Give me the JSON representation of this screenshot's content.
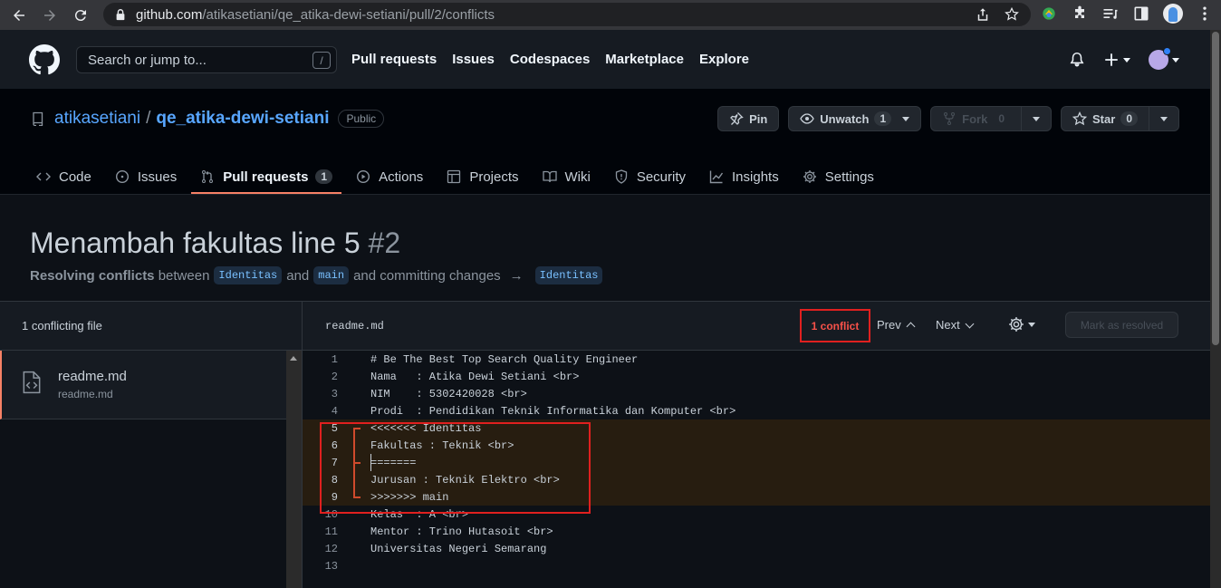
{
  "browser": {
    "url_host": "github.com",
    "url_path": "/atikasetiani/qe_atika-dewi-setiani/pull/2/conflicts"
  },
  "header": {
    "search_placeholder": "Search or jump to...",
    "slash_key": "/",
    "nav": [
      "Pull requests",
      "Issues",
      "Codespaces",
      "Marketplace",
      "Explore"
    ]
  },
  "repo": {
    "owner": "atikasetiani",
    "separator": "/",
    "name": "qe_atika-dewi-setiani",
    "visibility": "Public",
    "pin_label": "Pin",
    "watch_label": "Unwatch",
    "watch_count": "1",
    "fork_label": "Fork",
    "fork_count": "0",
    "star_label": "Star",
    "star_count": "0",
    "tabs": [
      {
        "label": "Code",
        "icon": "code-icon"
      },
      {
        "label": "Issues",
        "icon": "issue-icon"
      },
      {
        "label": "Pull requests",
        "icon": "git-pull-request-icon",
        "count": "1",
        "active": true
      },
      {
        "label": "Actions",
        "icon": "play-icon"
      },
      {
        "label": "Projects",
        "icon": "table-icon"
      },
      {
        "label": "Wiki",
        "icon": "book-icon"
      },
      {
        "label": "Security",
        "icon": "shield-icon"
      },
      {
        "label": "Insights",
        "icon": "graph-icon"
      },
      {
        "label": "Settings",
        "icon": "gear-icon"
      }
    ]
  },
  "pr": {
    "title": "Menambah fakultas line 5",
    "number": "#2",
    "sub_prefix": "Resolving conflicts",
    "sub_between": "between",
    "head_branch": "Identitas",
    "sub_and": "and",
    "base_branch": "main",
    "sub_committing": "and committing changes",
    "arrow": "→",
    "target_branch": "Identitas"
  },
  "conflicts": {
    "file_count_label": "1 conflicting file",
    "files": [
      {
        "name": "readme.md",
        "path": "readme.md"
      }
    ],
    "current_file": "readme.md",
    "conflict_count": "1 conflict",
    "prev_label": "Prev",
    "next_label": "Next",
    "resolve_label": "Mark as resolved"
  },
  "code_lines": [
    {
      "n": "1",
      "text": "# Be The Best Top Search Quality Engineer"
    },
    {
      "n": "2",
      "text": "Nama   : Atika Dewi Setiani <br>"
    },
    {
      "n": "3",
      "text": "NIM    : 5302420028 <br>"
    },
    {
      "n": "4",
      "text": "Prodi  : Pendidikan Teknik Informatika dan Komputer <br>"
    },
    {
      "n": "5",
      "text": "<<<<<<< Identitas",
      "conflict": true,
      "marker": "start"
    },
    {
      "n": "6",
      "text": "Fakultas : Teknik <br>",
      "conflict": true,
      "marker": "mid"
    },
    {
      "n": "7",
      "text": "=======",
      "conflict": true,
      "marker": "sep"
    },
    {
      "n": "8",
      "text": "Jurusan : Teknik Elektro <br>",
      "conflict": true,
      "marker": "mid"
    },
    {
      "n": "9",
      "text": ">>>>>>> main",
      "conflict": true,
      "marker": "end"
    },
    {
      "n": "10",
      "text": "Kelas  : A <br>"
    },
    {
      "n": "11",
      "text": "Mentor : Trino Hutasoit <br>"
    },
    {
      "n": "12",
      "text": "Universitas Negeri Semarang"
    },
    {
      "n": "13",
      "text": ""
    }
  ]
}
